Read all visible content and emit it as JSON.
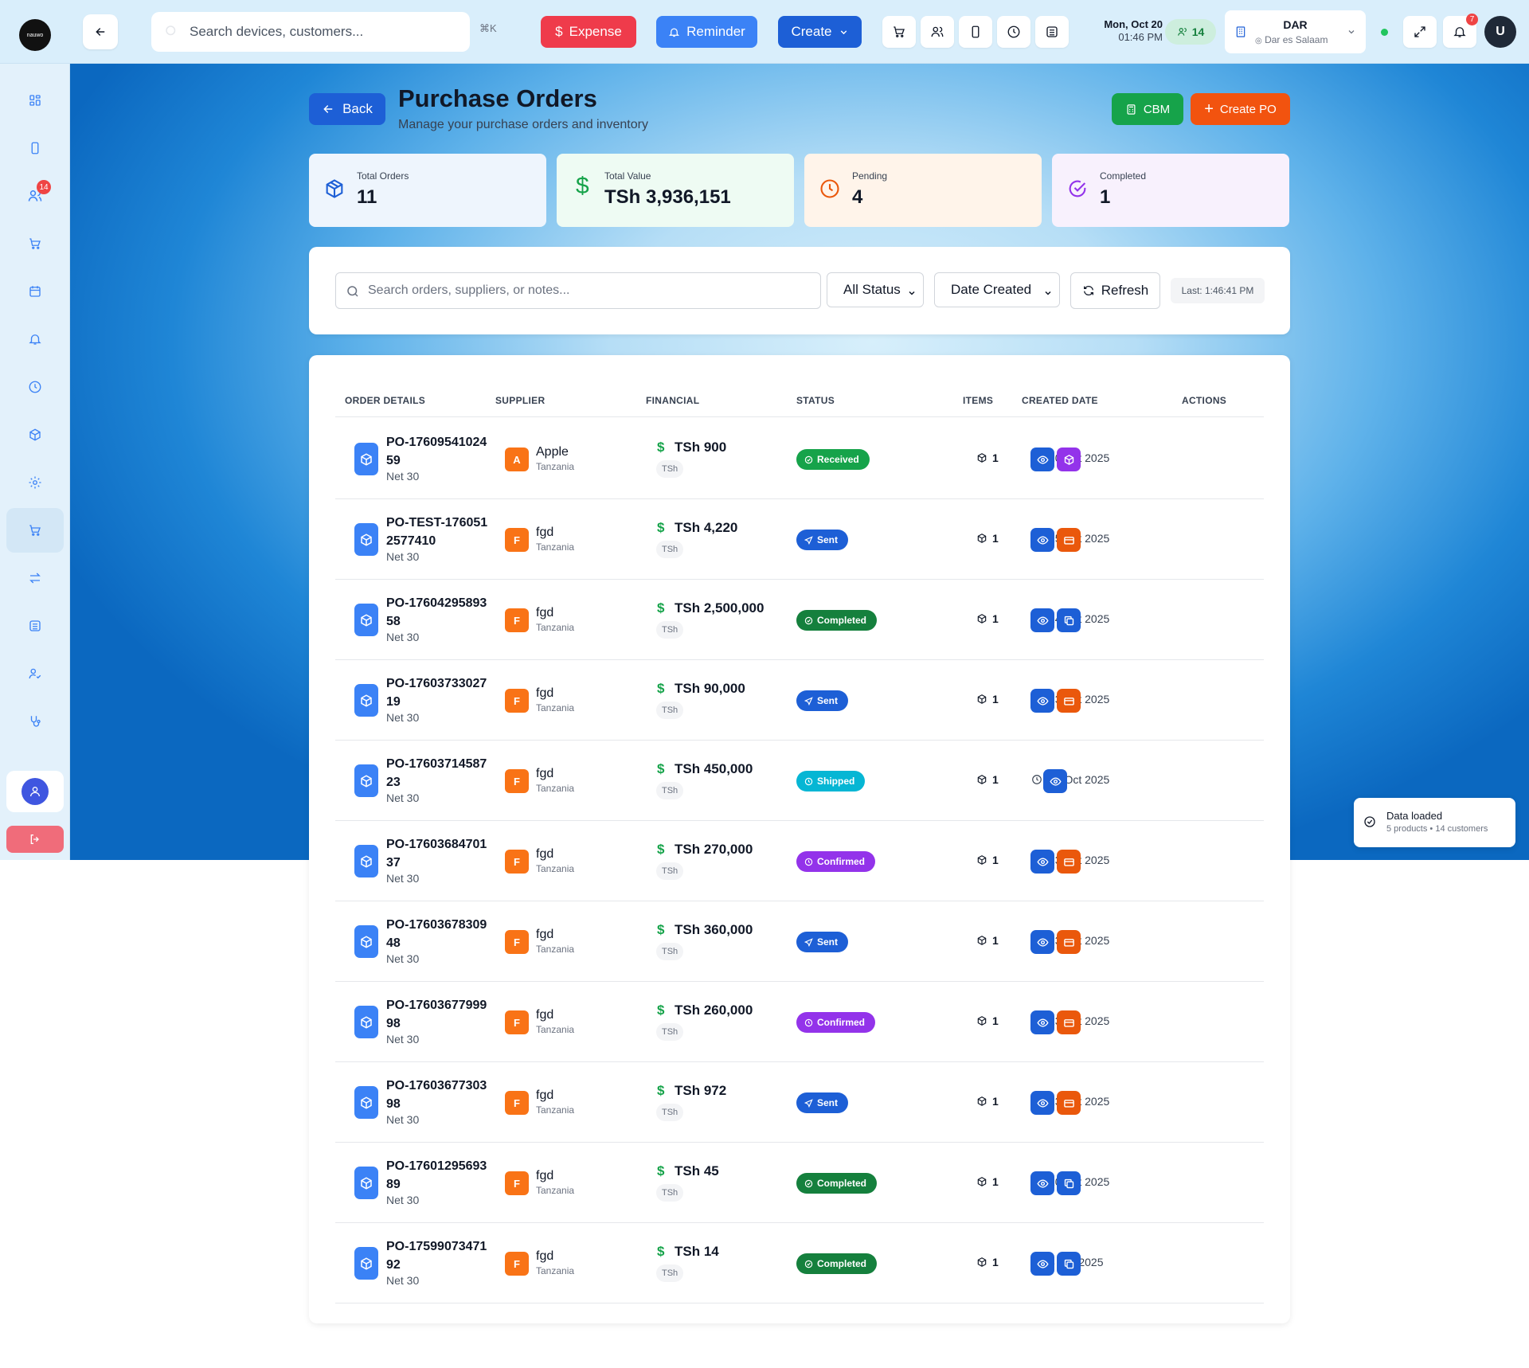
{
  "app": {
    "logo_text": "nauwo"
  },
  "topbar": {
    "search_placeholder": "Search devices, customers...",
    "shortcut": "⌘K",
    "expense_label": "Expense",
    "reminder_label": "Reminder",
    "create_label": "Create",
    "date": "Mon, Oct 20",
    "time": "01:46 PM",
    "online_count": "14",
    "location_code": "DAR",
    "location_name": "Dar es Salaam",
    "notification_count": "7",
    "user_initial": "U"
  },
  "sidebar": {
    "customers_badge": "14"
  },
  "page": {
    "back_label": "Back",
    "title": "Purchase Orders",
    "subtitle": "Manage your purchase orders and inventory",
    "cbm_label": "CBM",
    "create_po_label": "Create PO"
  },
  "stats": [
    {
      "label": "Total Orders",
      "value": "11"
    },
    {
      "label": "Total Value",
      "value": "TSh 3,936,151"
    },
    {
      "label": "Pending",
      "value": "4"
    },
    {
      "label": "Completed",
      "value": "1"
    }
  ],
  "filters": {
    "search_placeholder": "Search orders, suppliers, or notes...",
    "status_select": "All Status",
    "sort_select": "Date Created",
    "refresh_label": "Refresh",
    "last_updated": "Last: 1:46:41 PM"
  },
  "table": {
    "headers": [
      "ORDER DETAILS",
      "SUPPLIER",
      "FINANCIAL",
      "STATUS",
      "ITEMS",
      "CREATED DATE",
      "ACTIONS"
    ],
    "rows": [
      {
        "po_number": "PO-1760954102459",
        "terms": "Net 30",
        "supplier_initial": "A",
        "supplier_name": "Apple",
        "supplier_country": "Tanzania",
        "amount": "TSh 900",
        "currency": "TSh",
        "status": "Received",
        "items": "1",
        "created": "20 Oct 2025"
      },
      {
        "po_number": "PO-TEST-1760512577410",
        "terms": "Net 30",
        "supplier_initial": "F",
        "supplier_name": "fgd",
        "supplier_country": "Tanzania",
        "amount": "TSh 4,220",
        "currency": "TSh",
        "status": "Sent",
        "items": "1",
        "created": "15 Oct 2025"
      },
      {
        "po_number": "PO-1760429589358",
        "terms": "Net 30",
        "supplier_initial": "F",
        "supplier_name": "fgd",
        "supplier_country": "Tanzania",
        "amount": "TSh 2,500,000",
        "currency": "TSh",
        "status": "Completed",
        "items": "1",
        "created": "14 Oct 2025"
      },
      {
        "po_number": "PO-1760373302719",
        "terms": "Net 30",
        "supplier_initial": "F",
        "supplier_name": "fgd",
        "supplier_country": "Tanzania",
        "amount": "TSh 90,000",
        "currency": "TSh",
        "status": "Sent",
        "items": "1",
        "created": "13 Oct 2025"
      },
      {
        "po_number": "PO-1760371458723",
        "terms": "Net 30",
        "supplier_initial": "F",
        "supplier_name": "fgd",
        "supplier_country": "Tanzania",
        "amount": "TSh 450,000",
        "currency": "TSh",
        "status": "Shipped",
        "items": "1",
        "created": "13 Oct 2025"
      },
      {
        "po_number": "PO-1760368470137",
        "terms": "Net 30",
        "supplier_initial": "F",
        "supplier_name": "fgd",
        "supplier_country": "Tanzania",
        "amount": "TSh 270,000",
        "currency": "TSh",
        "status": "Confirmed",
        "items": "1",
        "created": "13 Oct 2025"
      },
      {
        "po_number": "PO-1760367830948",
        "terms": "Net 30",
        "supplier_initial": "F",
        "supplier_name": "fgd",
        "supplier_country": "Tanzania",
        "amount": "TSh 360,000",
        "currency": "TSh",
        "status": "Sent",
        "items": "1",
        "created": "13 Oct 2025"
      },
      {
        "po_number": "PO-1760367799998",
        "terms": "Net 30",
        "supplier_initial": "F",
        "supplier_name": "fgd",
        "supplier_country": "Tanzania",
        "amount": "TSh 260,000",
        "currency": "TSh",
        "status": "Confirmed",
        "items": "1",
        "created": "13 Oct 2025"
      },
      {
        "po_number": "PO-1760367730398",
        "terms": "Net 30",
        "supplier_initial": "F",
        "supplier_name": "fgd",
        "supplier_country": "Tanzania",
        "amount": "TSh 972",
        "currency": "TSh",
        "status": "Sent",
        "items": "1",
        "created": "13 Oct 2025"
      },
      {
        "po_number": "PO-1760129569389",
        "terms": "Net 30",
        "supplier_initial": "F",
        "supplier_name": "fgd",
        "supplier_country": "Tanzania",
        "amount": "TSh 45",
        "currency": "TSh",
        "status": "Completed",
        "items": "1",
        "created": "10 Oct 2025"
      },
      {
        "po_number": "PO-1759907347192",
        "terms": "Net 30",
        "supplier_initial": "F",
        "supplier_name": "fgd",
        "supplier_country": "Tanzania",
        "amount": "TSh 14",
        "currency": "TSh",
        "status": "Completed",
        "items": "1",
        "created": "8 Oct 2025"
      }
    ]
  },
  "status_colors": {
    "Received": "#16a34a",
    "Sent": "#1d5fd6",
    "Completed": "#15803d",
    "Shipped": "#06b6d4",
    "Confirmed": "#9333ea"
  },
  "toast": {
    "title": "Data loaded",
    "detail": "5 products • 14 customers"
  }
}
